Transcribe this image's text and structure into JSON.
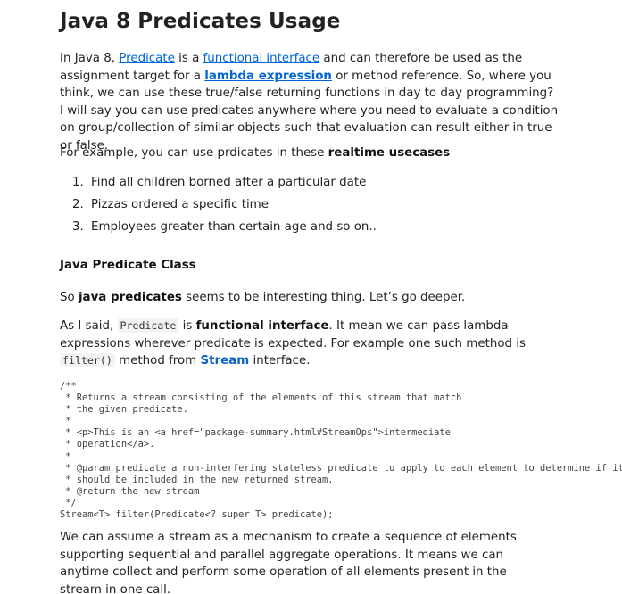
{
  "title": "Java 8 Predicates Usage",
  "intro": {
    "t1": "In Java 8, ",
    "predicate_link": "Predicate",
    "t2": " is a ",
    "functional_interface_link": "functional interface",
    "t3": " and can therefore be used as the assignment target for a ",
    "lambda_link": "lambda expression",
    "t4": " or method reference. So, where you think, we can use these true/false returning functions in day to day programming? I will say you can use predicates anywhere where you need to evaluate a condition on group/collection of similar objects such that evaluation can result either in true or false."
  },
  "example": {
    "t1": "For example, you can use prdicates in these ",
    "bold": "realtime usecases"
  },
  "usecases": [
    {
      "num": "1.",
      "text": "Find all children borned after a particular date"
    },
    {
      "num": "2.",
      "text": "Pizzas ordered a specific time"
    },
    {
      "num": "3.",
      "text": "Employees greater than certain age and so on.."
    }
  ],
  "section_heading": "Java Predicate Class",
  "deeper": {
    "t1": "So ",
    "bold": "java predicates",
    "t2": " seems to be interesting thing. Let’s go deeper."
  },
  "said": {
    "t1": "As I said, ",
    "code1": "Predicate",
    "t2": " is ",
    "bold": "functional interface",
    "t3": ". It mean we can pass lambda expressions wherever predicate is expected. For example one such method is ",
    "code2": "filter()",
    "t4": " method from ",
    "stream": "Stream",
    "t5": " interface."
  },
  "code_block": "/**\n * Returns a stream consisting of the elements of this stream that match\n * the given predicate.\n *\n * <p>This is an <a href=\"package-summary.html#StreamOps\">intermediate\n * operation</a>.\n *\n * @param predicate a non-interfering stateless predicate to apply to each element to determine if it\n * should be included in the new returned stream.\n * @return the new stream\n */\nStream<T> filter(Predicate<? super T> predicate);",
  "closing": "We can assume a stream as a mechanism to create a sequence of elements supporting sequential and parallel aggregate operations. It means we can anytime collect and perform some operation of all elements present in the stream in one call."
}
